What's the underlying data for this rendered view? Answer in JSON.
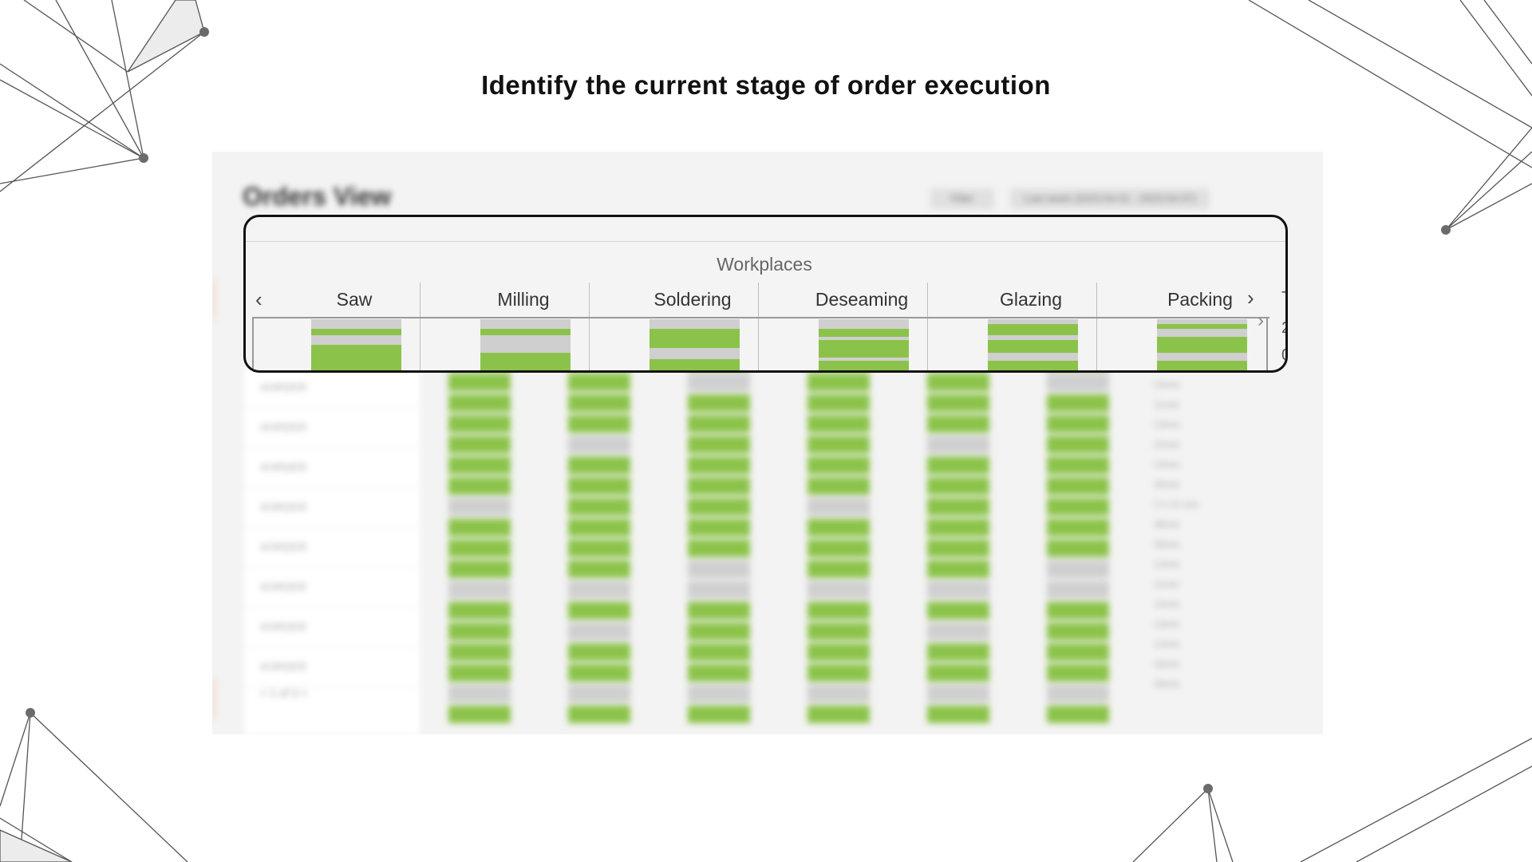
{
  "slide": {
    "title": "Identify the current stage of order execution"
  },
  "background_app": {
    "page_title": "Orders View",
    "filter_label": "Filter",
    "date_range": "Last week (2023-04-01 - 2023-04-07)",
    "list_items": [
      "#ORDER",
      "#ORDER",
      "#ORDER",
      "#ORDER",
      "#ORDER",
      "#ORDER",
      "#ORDER",
      "#ORDER"
    ],
    "pager": "< 1 of 3 >",
    "times": [
      "15min",
      "11min",
      "13min",
      "22min",
      "15min",
      "35min",
      "2 h 15 min",
      "48min",
      "38min",
      "13min",
      "11min",
      "14min",
      "13min",
      "12min",
      "18min",
      "28min"
    ]
  },
  "panel": {
    "heading": "Workplaces",
    "prev_label": "‹",
    "next_label": "›",
    "edge_chars": [
      "T",
      "2",
      "0"
    ],
    "stages": [
      {
        "label": "Saw",
        "bar": [
          {
            "color": "#cfcfcf",
            "h": 12
          },
          {
            "color": "#8bc34a",
            "h": 8
          },
          {
            "color": "#cfcfcf",
            "h": 12
          },
          {
            "color": "#8bc34a",
            "h": 38
          }
        ]
      },
      {
        "label": "Milling",
        "bar": [
          {
            "color": "#cfcfcf",
            "h": 12
          },
          {
            "color": "#8bc34a",
            "h": 8
          },
          {
            "color": "#cfcfcf",
            "h": 22
          },
          {
            "color": "#8bc34a",
            "h": 28
          }
        ]
      },
      {
        "label": "Soldering",
        "bar": [
          {
            "color": "#cfcfcf",
            "h": 12
          },
          {
            "color": "#8bc34a",
            "h": 24
          },
          {
            "color": "#cfcfcf",
            "h": 14
          },
          {
            "color": "#8bc34a",
            "h": 20
          }
        ]
      },
      {
        "label": "Deseaming",
        "bar": [
          {
            "color": "#cfcfcf",
            "h": 12
          },
          {
            "color": "#8bc34a",
            "h": 10
          },
          {
            "color": "#cfcfcf",
            "h": 4
          },
          {
            "color": "#8bc34a",
            "h": 22
          },
          {
            "color": "#cfcfcf",
            "h": 4
          },
          {
            "color": "#8bc34a",
            "h": 18
          }
        ]
      },
      {
        "label": "Glazing",
        "bar": [
          {
            "color": "#cfcfcf",
            "h": 6
          },
          {
            "color": "#8bc34a",
            "h": 14
          },
          {
            "color": "#cfcfcf",
            "h": 6
          },
          {
            "color": "#8bc34a",
            "h": 16
          },
          {
            "color": "#cfcfcf",
            "h": 10
          },
          {
            "color": "#8bc34a",
            "h": 18
          }
        ]
      },
      {
        "label": "Packing",
        "bar": [
          {
            "color": "#cfcfcf",
            "h": 6
          },
          {
            "color": "#8bc34a",
            "h": 6
          },
          {
            "color": "#cfcfcf",
            "h": 10
          },
          {
            "color": "#8bc34a",
            "h": 20
          },
          {
            "color": "#cfcfcf",
            "h": 10
          },
          {
            "color": "#8bc34a",
            "h": 18
          }
        ]
      }
    ]
  },
  "colors": {
    "accent_green": "#8bc34a",
    "idle_gray": "#cfcfcf",
    "frame": "#111111"
  }
}
